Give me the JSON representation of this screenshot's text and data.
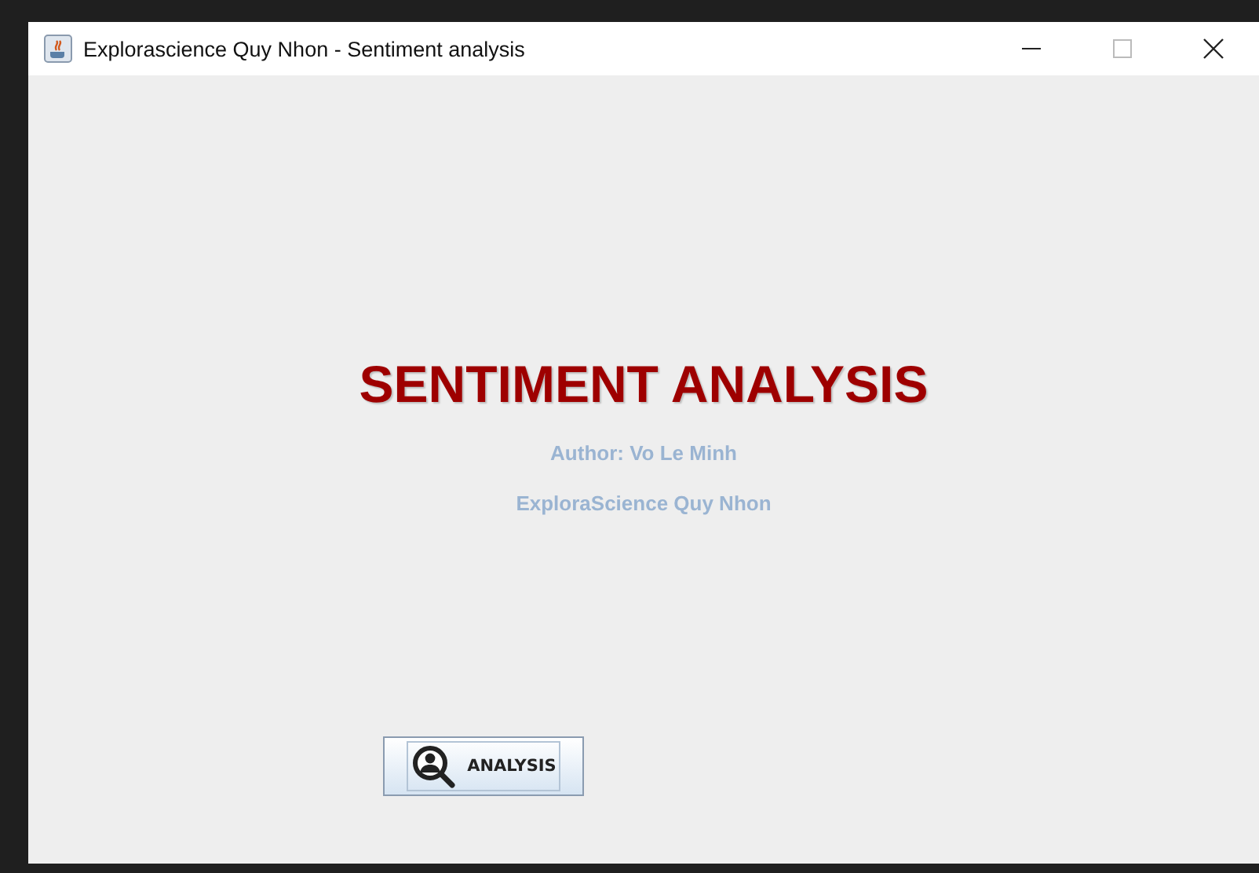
{
  "window": {
    "title": "Explorascience Quy Nhon - Sentiment analysis"
  },
  "heading": "SENTIMENT ANALYSIS",
  "author": "Author: Vo Le Minh",
  "affiliation": "ExploraScience Quy Nhon",
  "buttons": [
    {
      "label": "ANALYSIS"
    }
  ]
}
